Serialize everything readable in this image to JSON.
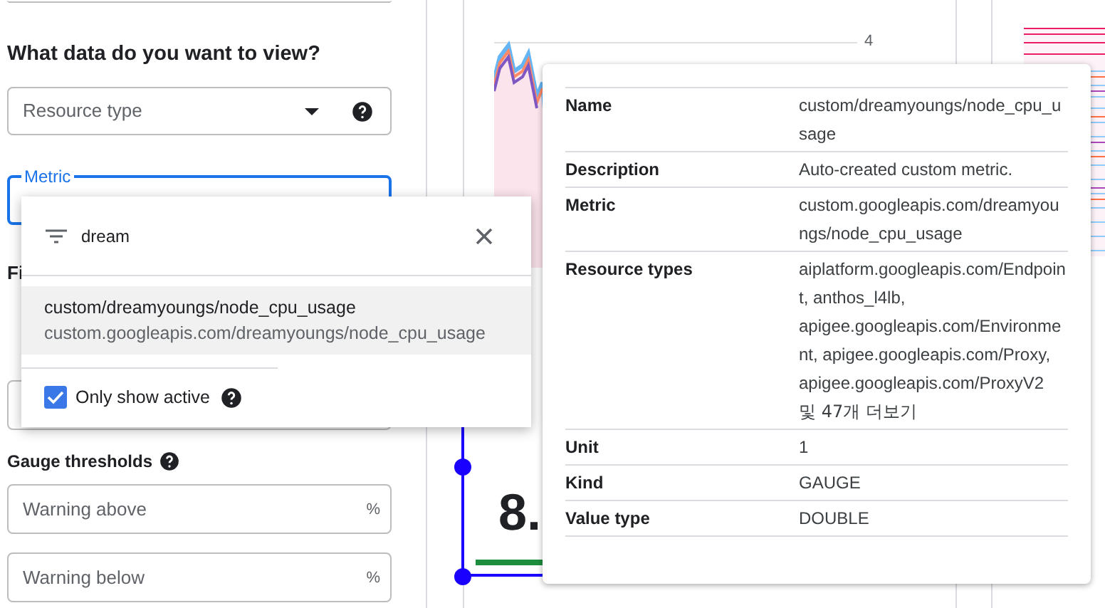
{
  "left_panel": {
    "heading": "What data do you want to view?",
    "resource_type": {
      "placeholder": "Resource type"
    },
    "metric": {
      "label": "Metric",
      "focused": true
    },
    "section_fragment": "Fi",
    "gauge_thresholds": {
      "label": "Gauge thresholds"
    },
    "warning_above": {
      "placeholder": "Warning above",
      "unit": "%"
    },
    "warning_below": {
      "placeholder": "Warning below",
      "unit": "%"
    }
  },
  "canvas": {
    "y_tick": "4",
    "scorecard_value": "8."
  },
  "metric_dropdown": {
    "search": {
      "value": "dream"
    },
    "options": [
      {
        "name": "custom/dreamyoungs/node_cpu_usage",
        "type": "custom.googleapis.com/dreamyoungs/node_cpu_usage",
        "selected": true
      }
    ],
    "only_show_active": {
      "label": "Only show active",
      "checked": true
    }
  },
  "metric_details": [
    {
      "label": "Name",
      "value": "custom/dreamyoungs/node_cpu_usage"
    },
    {
      "label": "Description",
      "value": "Auto-created custom metric."
    },
    {
      "label": "Metric",
      "value": "custom.googleapis.com/dreamyoungs/node_cpu_usage"
    },
    {
      "label": "Resource types",
      "value": "aiplatform.googleapis.com/Endpoint, anthos_l4lb, apigee.googleapis.com/Environment, apigee.googleapis.com/Proxy, apigee.googleapis.com/ProxyV2",
      "more": "및 47개 더보기"
    },
    {
      "label": "Unit",
      "value": "1"
    },
    {
      "label": "Kind",
      "value": "GAUGE"
    },
    {
      "label": "Value type",
      "value": "DOUBLE"
    }
  ]
}
